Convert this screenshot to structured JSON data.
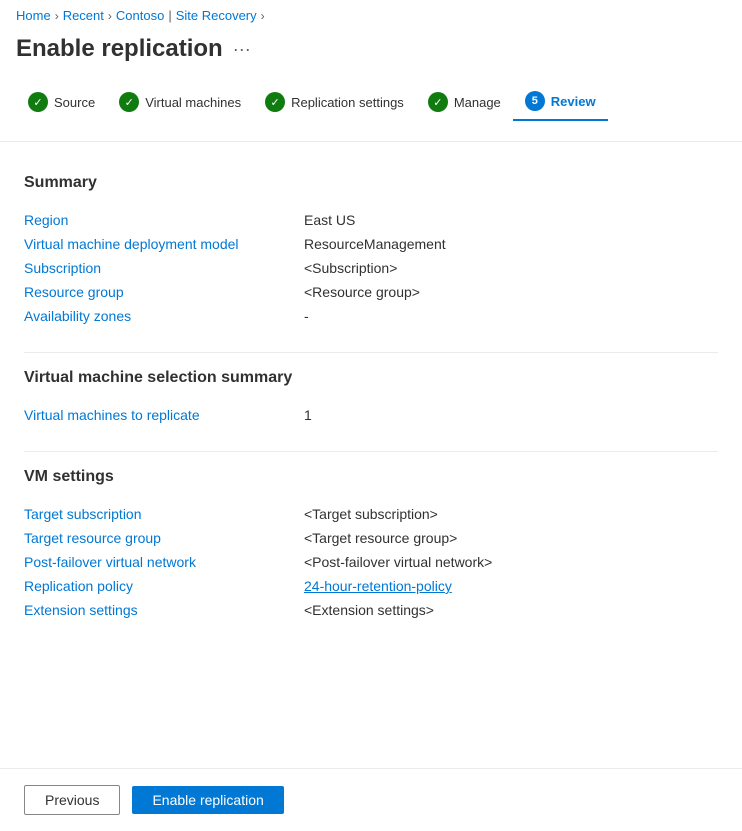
{
  "breadcrumb": {
    "home": "Home",
    "recent": "Recent",
    "contoso": "Contoso",
    "site_recovery": "Site Recovery"
  },
  "page": {
    "title": "Enable replication",
    "more_icon": "···"
  },
  "steps": [
    {
      "id": "source",
      "label": "Source",
      "state": "complete"
    },
    {
      "id": "virtual-machines",
      "label": "Virtual machines",
      "state": "complete"
    },
    {
      "id": "replication-settings",
      "label": "Replication settings",
      "state": "complete"
    },
    {
      "id": "manage",
      "label": "Manage",
      "state": "complete"
    },
    {
      "id": "review",
      "label": "Review",
      "state": "active",
      "number": "5"
    }
  ],
  "summary_section": {
    "title": "Summary",
    "rows": [
      {
        "label": "Region",
        "value": "East US",
        "type": "text"
      },
      {
        "label": "Virtual machine deployment model",
        "value": "ResourceManagement",
        "type": "text"
      },
      {
        "label": "Subscription",
        "value": "<Subscription>",
        "type": "text"
      },
      {
        "label": "Resource group",
        "value": "<Resource group>",
        "type": "text"
      },
      {
        "label": "Availability zones",
        "value": "-",
        "type": "text"
      }
    ]
  },
  "vm_selection_section": {
    "title": "Virtual machine selection summary",
    "rows": [
      {
        "label": "Virtual machines to replicate",
        "value": "1",
        "type": "text"
      }
    ]
  },
  "vm_settings_section": {
    "title": "VM settings",
    "rows": [
      {
        "label": "Target subscription",
        "value": "<Target subscription>",
        "type": "text"
      },
      {
        "label": "Target resource group",
        "value": "<Target resource group>",
        "type": "text"
      },
      {
        "label": "Post-failover virtual network",
        "value": "<Post-failover virtual network>",
        "type": "text"
      },
      {
        "label": "Replication policy",
        "value": "24-hour-retention-policy",
        "type": "link"
      },
      {
        "label": "Extension settings",
        "value": "<Extension settings>",
        "type": "text"
      }
    ]
  },
  "footer": {
    "previous_label": "Previous",
    "enable_label": "Enable replication"
  }
}
